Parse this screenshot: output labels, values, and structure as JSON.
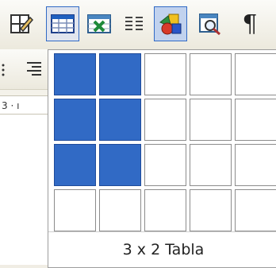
{
  "toolbar": {
    "buttons": [
      {
        "icon": "draw-table-icon"
      },
      {
        "icon": "insert-table-icon"
      },
      {
        "icon": "insert-excel-sheet-icon"
      },
      {
        "icon": "columns-icon"
      },
      {
        "icon": "drawing-icon"
      },
      {
        "icon": "document-map-icon"
      },
      {
        "icon": "show-hide-icon",
        "glyph": "¶"
      }
    ]
  },
  "ruler": {
    "text": "3 · ı"
  },
  "table_picker": {
    "rows": 4,
    "cols": 5,
    "selected_rows": 3,
    "selected_cols": 2,
    "caption": "3 x 2 Tabla",
    "selected_color": "#316ac5"
  }
}
